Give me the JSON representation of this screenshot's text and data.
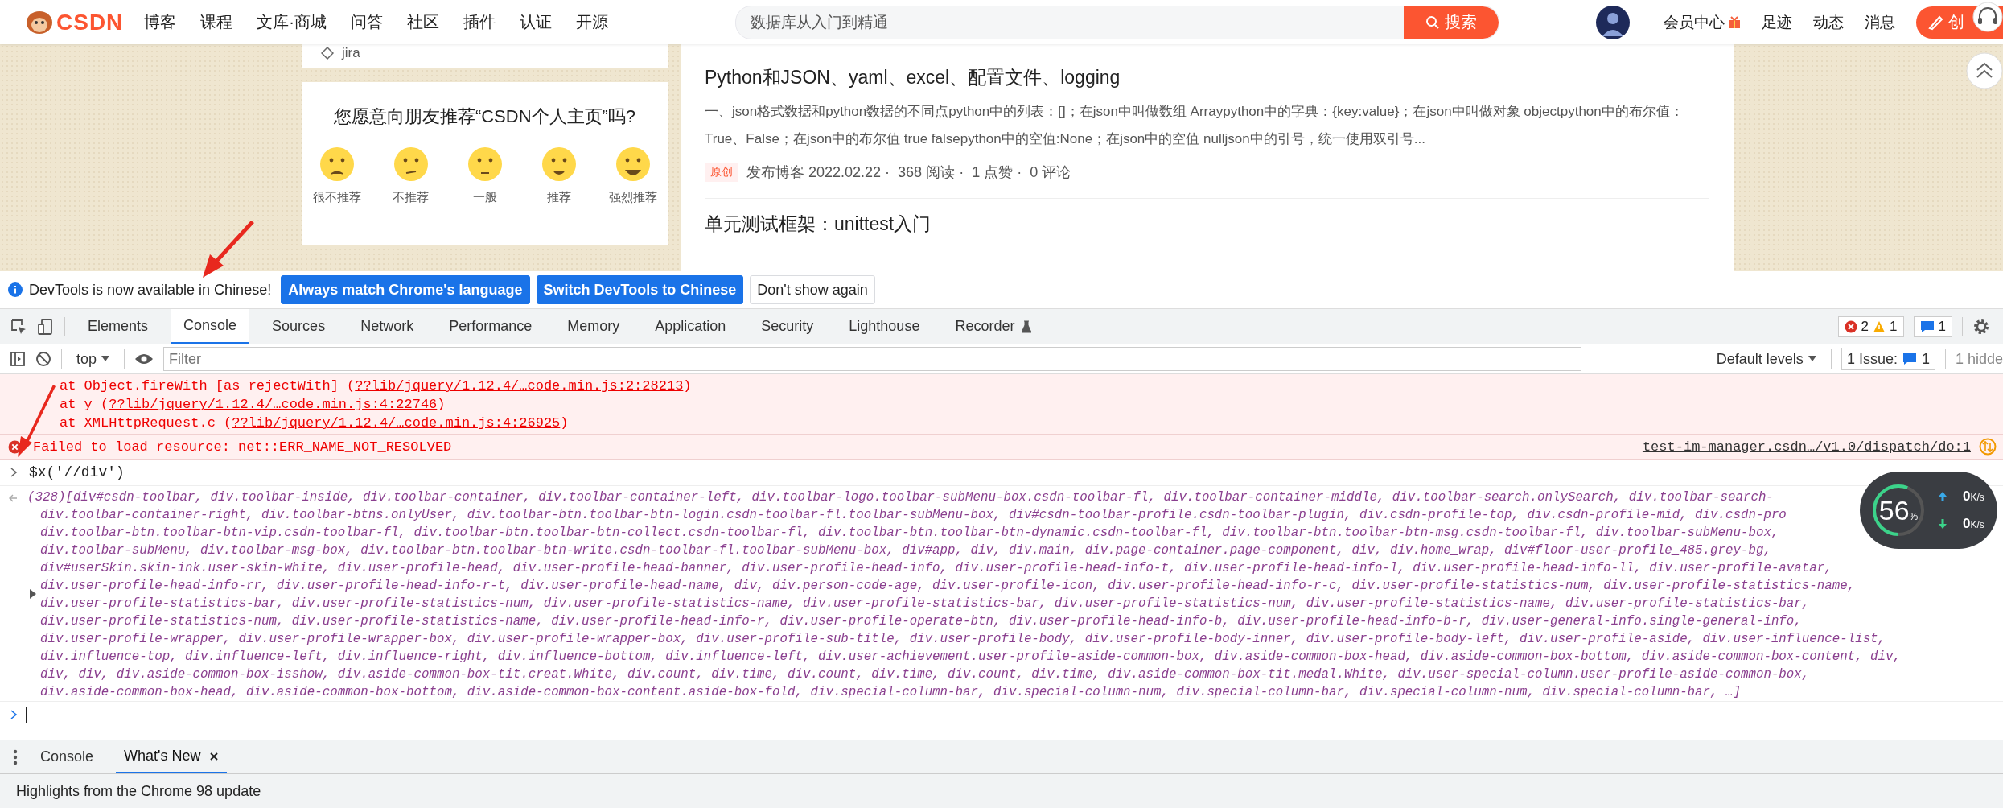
{
  "header": {
    "logo": "CSDN",
    "nav": [
      "博客",
      "课程",
      "文库·商城",
      "问答",
      "社区",
      "插件",
      "认证",
      "开源"
    ],
    "search": {
      "placeholder": "数据库从入门到精通",
      "button": "搜索"
    },
    "links": [
      "会员中心",
      "足迹",
      "动态",
      "消息"
    ],
    "create_button": "创"
  },
  "sidebar": {
    "tag": "jira",
    "survey": {
      "question": "您愿意向朋友推荐“CSDN个人主页”吗?",
      "options": [
        "很不推荐",
        "不推荐",
        "一般",
        "推荐",
        "强烈推荐"
      ]
    }
  },
  "articles": [
    {
      "title": "Python和JSON、yaml、excel、配置文件、logging",
      "summary": "一、json格式数据和python数据的不同点python中的列表：[]；在json中叫做数组 Arraypython中的字典：{key:value}；在json中叫做对象 objectpython中的布尔值：True、False；在json中的布尔值 true falsepython中的空值:None；在json中的空值 nulljson中的引号，统一使用双引号...",
      "badge": "原创",
      "meta": [
        "发布博客 2022.02.22 ·",
        "368 阅读 ·",
        "1 点赞 ·",
        "0 评论"
      ]
    },
    {
      "title": "单元测试框架：unittest入门"
    }
  ],
  "devtools": {
    "infobar": {
      "text": "DevTools is now available in Chinese!",
      "buttons": [
        {
          "label": "Always match Chrome's language",
          "primary": true
        },
        {
          "label": "Switch DevTools to Chinese",
          "primary": true
        },
        {
          "label": "Don't show again",
          "primary": false
        }
      ]
    },
    "tabs": [
      {
        "label": "Elements",
        "selected": false
      },
      {
        "label": "Console",
        "selected": true
      },
      {
        "label": "Sources",
        "selected": false
      },
      {
        "label": "Network",
        "selected": false
      },
      {
        "label": "Performance",
        "selected": false
      },
      {
        "label": "Memory",
        "selected": false
      },
      {
        "label": "Application",
        "selected": false
      },
      {
        "label": "Security",
        "selected": false
      },
      {
        "label": "Lighthouse",
        "selected": false
      },
      {
        "label": "Recorder",
        "selected": false
      }
    ],
    "counts": {
      "errors": "2",
      "warnings": "1",
      "messages": "1"
    },
    "toolbar": {
      "context": "top",
      "filter_placeholder": "Filter",
      "levels": "Default levels",
      "issues_label": "1 Issue:",
      "issues_count": "1",
      "hidden": "1 hidde"
    },
    "messages": [
      {
        "kind": "stack",
        "lines": [
          {
            "prefix": "at Object.fireWith [as rejectWith] (",
            "link": "??lib/jquery/1.12.4/…code.min.js:2:28213",
            "suffix": ")"
          },
          {
            "prefix": "at y (",
            "link": "??lib/jquery/1.12.4/…code.min.js:4:22746",
            "suffix": ")"
          },
          {
            "prefix": "at XMLHttpRequest.c (",
            "link": "??lib/jquery/1.12.4/…code.min.js:4:26925",
            "suffix": ")"
          }
        ]
      },
      {
        "kind": "error",
        "text": "Failed to load resource: net::ERR_NAME_NOT_RESOLVED",
        "source": "test-im-manager.csdn…/v1.0/dispatch/do:1"
      },
      {
        "kind": "input",
        "text": "$x('//div')"
      },
      {
        "kind": "output",
        "count": "(328)",
        "lines": [
          "[div#csdn-toolbar, div.toolbar-inside, div.toolbar-container, div.toolbar-container-left, div.toolbar-logo.toolbar-subMenu-box.csdn-toolbar-fl, div.toolbar-container-middle, div.toolbar-search.onlySearch, div.toolbar-search-",
          "div.toolbar-container-right, div.toolbar-btns.onlyUser, div.toolbar-btn.toolbar-btn-login.csdn-toolbar-fl.toolbar-subMenu-box, div#csdn-toolbar-profile.csdn-toolbar-plugin, div.csdn-profile-top, div.csdn-profile-mid, div.csdn-pro",
          "div.toolbar-btn.toolbar-btn-vip.csdn-toolbar-fl, div.toolbar-btn.toolbar-btn-collect.csdn-toolbar-fl, div.toolbar-btn.toolbar-btn-dynamic.csdn-toolbar-fl, div.toolbar-btn.toolbar-btn-msg.csdn-toolbar-fl, div.toolbar-subMenu-box,",
          "div.toolbar-subMenu, div.toolbar-msg-box, div.toolbar-btn.toolbar-btn-write.csdn-toolbar-fl.toolbar-subMenu-box, div#app, div, div.main, div.page-container.page-component, div, div.home_wrap, div#floor-user-profile_485.grey-bg,",
          "div#userSkin.skin-ink.user-skin-White, div.user-profile-head, div.user-profile-head-banner, div.user-profile-head-info, div.user-profile-head-info-t, div.user-profile-head-info-l, div.user-profile-head-info-ll, div.user-profile-avatar,",
          "div.user-profile-head-info-rr, div.user-profile-head-info-r-t, div.user-profile-head-name, div, div.person-code-age, div.user-profile-icon, div.user-profile-head-info-r-c, div.user-profile-statistics-num, div.user-profile-statistics-name,",
          "div.user-profile-statistics-bar, div.user-profile-statistics-num, div.user-profile-statistics-name, div.user-profile-statistics-bar, div.user-profile-statistics-num, div.user-profile-statistics-name, div.user-profile-statistics-bar,",
          "div.user-profile-statistics-num, div.user-profile-statistics-name, div.user-profile-head-info-r, div.user-profile-operate-btn, div.user-profile-head-info-b, div.user-profile-head-info-b-r, div.user-general-info.single-general-info,",
          "div.user-profile-wrapper, div.user-profile-wrapper-box, div.user-profile-wrapper-box, div.user-profile-sub-title, div.user-profile-body, div.user-profile-body-inner, div.user-profile-body-left, div.user-profile-aside, div.user-influence-list,",
          "div.influence-top, div.influence-left, div.influence-right, div.influence-bottom, div.influence-left, div.user-achievement.user-profile-aside-common-box, div.aside-common-box-head, div.aside-common-box-bottom, div.aside-common-box-content, div,",
          "div, div, div.aside-common-box-isshow, div.aside-common-box-tit.creat.White, div.count, div.time, div.count, div.time, div.count, div.time, div.aside-common-box-tit.medal.White, div.user-special-column.user-profile-aside-common-box,",
          "div.aside-common-box-head, div.aside-common-box-bottom, div.aside-common-box-content.aside-box-fold, div.special-column-bar, div.special-column-num, div.special-column-bar, div.special-column-num, div.special-column-bar, …]"
        ]
      }
    ],
    "drawer": {
      "tabs": [
        {
          "label": "Console",
          "selected": false,
          "closable": false
        },
        {
          "label": "What's New",
          "selected": true,
          "closable": true
        }
      ],
      "message": "Highlights from the Chrome 98 update"
    }
  },
  "speed_widget": {
    "percent": "56",
    "unit": "%",
    "level": 0.56,
    "upload": {
      "value": "0",
      "unit": "K/s"
    },
    "download": {
      "value": "0",
      "unit": "K/s"
    }
  }
}
